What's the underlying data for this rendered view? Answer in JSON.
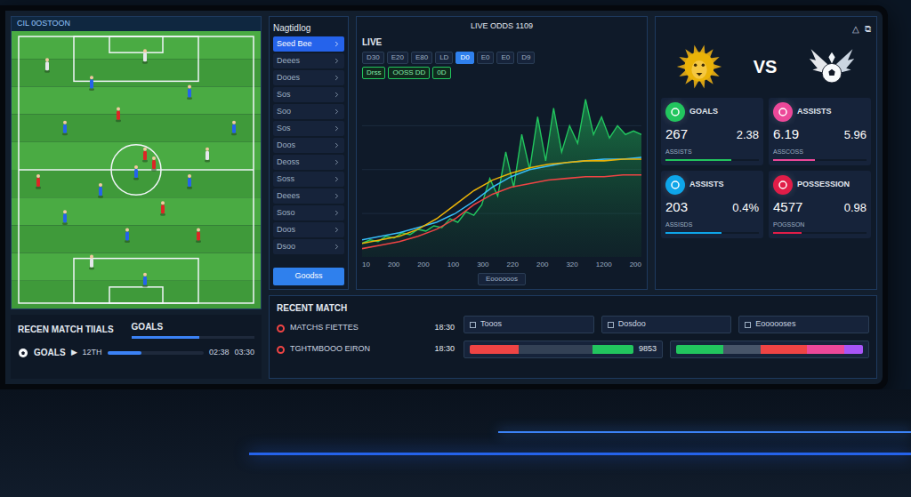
{
  "pitch_panel": {
    "header": "CIL 0OSTOON",
    "section_label": "RECEN MATCH TIIALS",
    "tab": {
      "label": "GOALS",
      "level": 0.55
    },
    "playback": {
      "label": "GOALS",
      "play": "▶",
      "time": "12TH",
      "level": 0.35,
      "elapsed": "02:38",
      "total": "03:30"
    }
  },
  "nav": {
    "title": "Nagtidlog",
    "items": [
      {
        "label": "Seed Bee",
        "selected": true
      },
      {
        "label": "Deees",
        "selected": false
      },
      {
        "label": "Dooes",
        "selected": false
      },
      {
        "label": "Sos",
        "selected": false
      },
      {
        "label": "Soo",
        "selected": false
      },
      {
        "label": "Sos",
        "selected": false
      },
      {
        "label": "Doos",
        "selected": false
      },
      {
        "label": "Deoss",
        "selected": false
      },
      {
        "label": "Soss",
        "selected": false
      },
      {
        "label": "Deees",
        "selected": false
      },
      {
        "label": "Soso",
        "selected": false
      },
      {
        "label": "Doos",
        "selected": false
      },
      {
        "label": "Dsoo",
        "selected": false
      }
    ],
    "button": "Goodss"
  },
  "chart": {
    "title": "LIVE ODDS 1109",
    "label": "LIVE",
    "tabs": [
      {
        "label": "D30",
        "selected": false
      },
      {
        "label": "E20",
        "selected": false
      },
      {
        "label": "E80",
        "selected": false
      },
      {
        "label": "LD",
        "selected": false
      },
      {
        "label": "D0",
        "selected": true
      },
      {
        "label": "E0",
        "selected": false
      },
      {
        "label": "E0",
        "selected": false
      },
      {
        "label": "D9",
        "selected": false
      }
    ],
    "badges": [
      "Drss",
      "OOSS DD",
      "0D"
    ],
    "series": [
      {
        "kind": "area",
        "color": "#22c55e",
        "values": [
          8,
          10,
          9,
          12,
          11,
          14,
          13,
          16,
          15,
          18,
          17,
          22,
          20,
          26,
          24,
          30,
          45,
          35,
          60,
          40,
          70,
          50,
          80,
          55,
          85,
          60,
          75,
          65,
          90,
          70,
          80,
          68,
          75,
          70,
          72,
          70
        ]
      },
      {
        "kind": "line",
        "color": "#38bdf8",
        "values": [
          10,
          12,
          14,
          17,
          20,
          25,
          32,
          40,
          46,
          50,
          52,
          54,
          55,
          56,
          56,
          57
        ]
      },
      {
        "kind": "line",
        "color": "#eab308",
        "values": [
          8,
          10,
          12,
          16,
          22,
          30,
          38,
          44,
          48,
          51,
          53,
          54,
          55,
          55,
          56,
          56
        ]
      },
      {
        "kind": "line",
        "color": "#ef4444",
        "values": [
          5,
          7,
          9,
          12,
          16,
          22,
          30,
          36,
          40,
          42,
          44,
          45,
          46,
          46,
          47,
          47
        ]
      }
    ],
    "x_ticks": [
      "10",
      "200",
      "200",
      "100",
      "300",
      "220",
      "200",
      "320",
      "1200",
      "200"
    ],
    "footer_button": "Eoooooos"
  },
  "match": {
    "vs": "VS",
    "corner_icons": [
      "△",
      "⧉"
    ],
    "stats": [
      {
        "label": "GOALS",
        "value": "267",
        "secondary": "2.38",
        "sub": "ASSISTS",
        "color": "#22c55e",
        "level": 0.7
      },
      {
        "label": "ASSISTS",
        "value": "6.19",
        "secondary": "5.96",
        "sub": "ASSCOSS",
        "color": "#ec4899",
        "level": 0.45
      },
      {
        "label": "ASSISTS",
        "value": "203",
        "secondary": "0.4%",
        "sub": "ASSISDS",
        "color": "#0ea5e9",
        "level": 0.6
      },
      {
        "label": "POSSESSION",
        "value": "4577",
        "secondary": "0.98",
        "sub": "POGSSON",
        "color": "#e11d48",
        "level": 0.3
      }
    ]
  },
  "recent": {
    "title": "RECENT MATCH",
    "matches": [
      {
        "name": "MATCHS FIETTES",
        "time": "18:30"
      },
      {
        "name": "TGHTMBOOO EIRON",
        "time": "18:30"
      }
    ],
    "cells": [
      "Tooos",
      "Dosdoo",
      "Eoooooses"
    ],
    "meters": [
      {
        "value": "9853",
        "segments": [
          {
            "color": "#ef4444",
            "level": 0.3
          },
          {
            "color": "#334155",
            "level": 0.45
          },
          {
            "color": "#22c55e",
            "level": 0.25
          }
        ]
      },
      {
        "segments": [
          {
            "color": "#22c55e",
            "level": 0.25
          },
          {
            "color": "#475569",
            "level": 0.2
          },
          {
            "color": "#ef4444",
            "level": 0.25
          },
          {
            "color": "#ec4899",
            "level": 0.2
          },
          {
            "color": "#a855f7",
            "level": 0.1
          }
        ]
      }
    ]
  }
}
